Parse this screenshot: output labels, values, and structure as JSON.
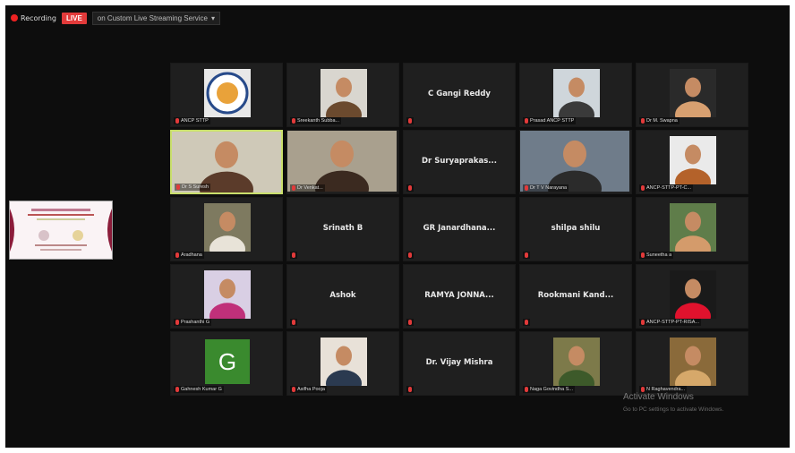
{
  "toolbar": {
    "recording_label": "Recording",
    "live_label": "LIVE",
    "service_label": "on Custom Live Streaming Service",
    "service_chevron": "▾"
  },
  "tiles": [
    {
      "name": "",
      "footer": "ANCP STTP",
      "type": "logo"
    },
    {
      "name": "",
      "footer": "Sreekanth Subba...",
      "type": "photo"
    },
    {
      "name": "C Gangi Reddy",
      "footer": "",
      "type": "name"
    },
    {
      "name": "",
      "footer": "Prasad ANCP STTP",
      "type": "photo"
    },
    {
      "name": "",
      "footer": "Dr M. Swapna",
      "type": "photo"
    },
    {
      "name": "",
      "footer": "Dr S Suresh",
      "type": "photo"
    },
    {
      "name": "",
      "footer": "Dr Venkat...",
      "type": "photo"
    },
    {
      "name": "Dr Suryaprakas...",
      "footer": "",
      "type": "name"
    },
    {
      "name": "",
      "footer": "Dr T V Narayana",
      "type": "photo"
    },
    {
      "name": "",
      "footer": "ANCP-STTP-PT-C...",
      "type": "photo"
    },
    {
      "name": "",
      "footer": "Aradhana",
      "type": "photo"
    },
    {
      "name": "Srinath B",
      "footer": "",
      "type": "name"
    },
    {
      "name": "GR Janardhana...",
      "footer": "",
      "type": "name"
    },
    {
      "name": "shilpa shilu",
      "footer": "",
      "type": "name"
    },
    {
      "name": "",
      "footer": "Suneetha a",
      "type": "photo"
    },
    {
      "name": "",
      "footer": "Prashanthi G",
      "type": "photo"
    },
    {
      "name": "Ashok",
      "footer": "",
      "type": "name"
    },
    {
      "name": "RAMYA JONNA...",
      "footer": "",
      "type": "name"
    },
    {
      "name": "Rookmani Kand...",
      "footer": "",
      "type": "name"
    },
    {
      "name": "",
      "footer": "ANCP-STTP-PT-RISA...",
      "type": "photo"
    },
    {
      "name": "G",
      "footer": "Gahnesh Kumar G",
      "type": "avatar"
    },
    {
      "name": "",
      "footer": "Asifha Pooja",
      "type": "photo"
    },
    {
      "name": "Dr. Vijay Mishra",
      "footer": "",
      "type": "name"
    },
    {
      "name": "",
      "footer": "Naga Govindha S...",
      "type": "photo"
    },
    {
      "name": "",
      "footer": "N Raghavendra...",
      "type": "photo"
    }
  ],
  "watermark": {
    "line1": "Activate Windows",
    "line2": "Go to PC settings to activate Windows."
  },
  "colors": {
    "active_speaker_border": "#c9df6c",
    "mic_muted": "#e23a3a",
    "avatar_green": "#3a8a2e"
  }
}
